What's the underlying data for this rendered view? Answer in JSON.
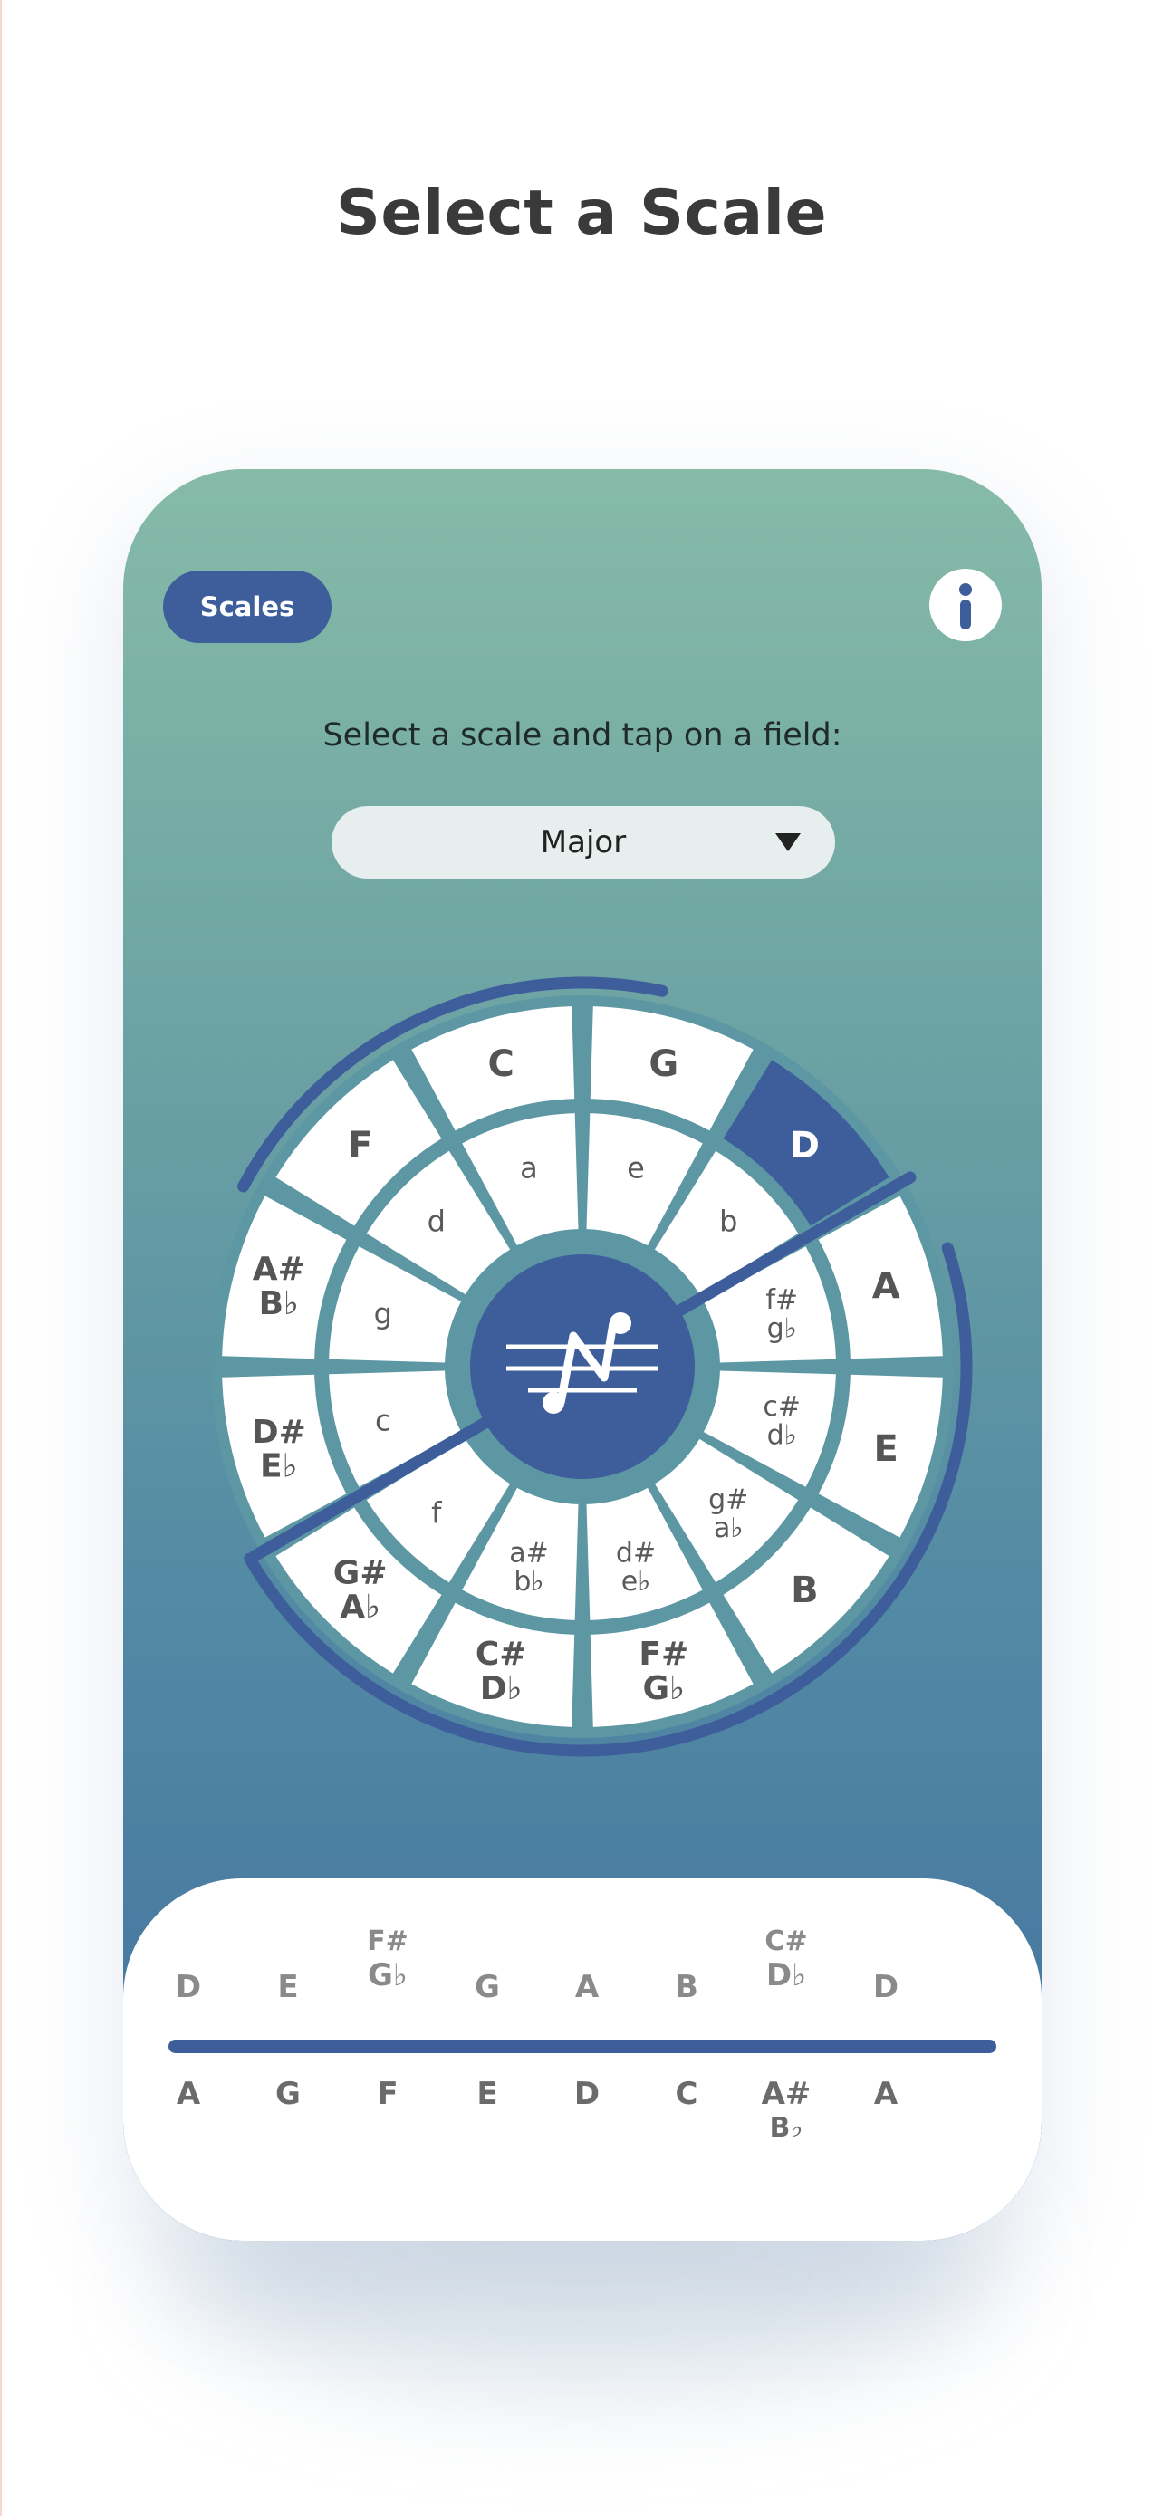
{
  "title": "Select a Scale",
  "header": {
    "scales_label": "Scales",
    "info_icon": "info-icon"
  },
  "instruction": "Select a scale and tap on a field:",
  "scale_select": {
    "value": "Major"
  },
  "colors": {
    "accent": "#3d5e9b",
    "wheel_stroke": "#5c97a3",
    "segment_fill": "#ffffff",
    "label": "#555555"
  },
  "wheel": {
    "center_icon": "note-logo-icon",
    "outer": [
      "C",
      "G",
      "D",
      "A",
      "E",
      "B",
      "F#\nG♭",
      "C#\nD♭",
      "G#\nA♭",
      "D#\nE♭",
      "A#\nB♭",
      "F"
    ],
    "inner": [
      "a",
      "e",
      "b",
      "f#\ng♭",
      "c#\nd♭",
      "g#\na♭",
      "d#\ne♭",
      "a#\nb♭",
      "f",
      "c",
      "g",
      "d"
    ],
    "selected_outer": "D"
  },
  "ascending": [
    {
      "top": "",
      "main": "D"
    },
    {
      "top": "",
      "main": "E"
    },
    {
      "top": "F#",
      "main": "G♭"
    },
    {
      "top": "",
      "main": "G"
    },
    {
      "top": "",
      "main": "A"
    },
    {
      "top": "",
      "main": "B"
    },
    {
      "top": "C#",
      "main": "D♭"
    },
    {
      "top": "",
      "main": "D"
    }
  ],
  "descending": [
    {
      "main": "A",
      "bottom": ""
    },
    {
      "main": "G",
      "bottom": ""
    },
    {
      "main": "F",
      "bottom": ""
    },
    {
      "main": "E",
      "bottom": ""
    },
    {
      "main": "D",
      "bottom": ""
    },
    {
      "main": "C",
      "bottom": ""
    },
    {
      "main": "A#",
      "bottom": "B♭"
    },
    {
      "main": "A",
      "bottom": ""
    }
  ]
}
